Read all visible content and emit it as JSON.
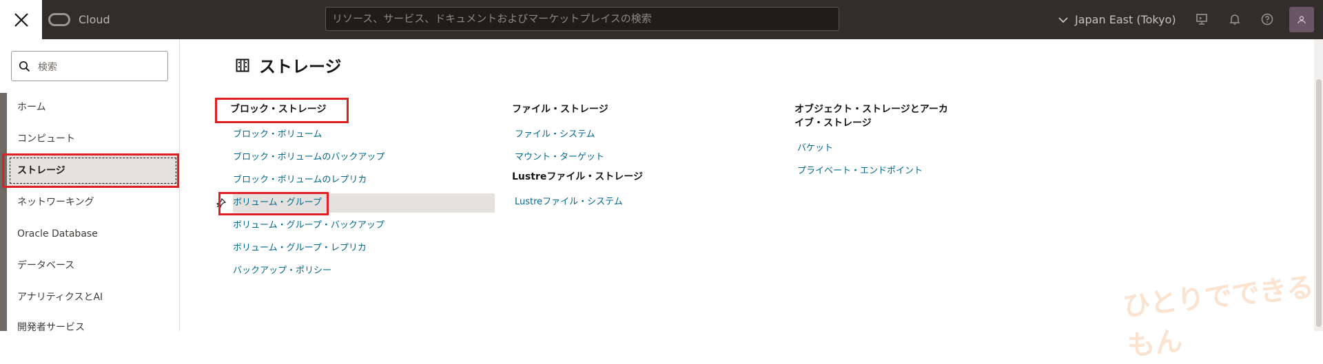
{
  "topbar": {
    "brand": "Cloud",
    "search_placeholder": "リソース、サービス、ドキュメントおよびマーケットプレイスの検索",
    "region": "Japan East (Tokyo)"
  },
  "sidebar": {
    "search_placeholder": "検索",
    "items": [
      {
        "label": "ホーム"
      },
      {
        "label": "コンピュート"
      },
      {
        "label": "ストレージ"
      },
      {
        "label": "ネットワーキング"
      },
      {
        "label": "Oracle Database"
      },
      {
        "label": "データベース"
      },
      {
        "label": "アナリティクスとAI"
      },
      {
        "label": "開発者サービス"
      }
    ]
  },
  "main": {
    "title": "ストレージ",
    "columns": [
      {
        "groups": [
          {
            "heading": "ブロック・ストレージ",
            "links": [
              "ブロック・ボリューム",
              "ブロック・ボリュームのバックアップ",
              "ブロック・ボリュームのレプリカ",
              "ボリューム・グループ",
              "ボリューム・グループ・バックアップ",
              "ボリューム・グループ・レプリカ",
              "バックアップ・ポリシー"
            ]
          }
        ]
      },
      {
        "groups": [
          {
            "heading": "ファイル・ストレージ",
            "links": [
              "ファイル・システム",
              "マウント・ターゲット"
            ]
          },
          {
            "heading": "Lustreファイル・ストレージ",
            "links": [
              "Lustreファイル・システム"
            ]
          }
        ]
      },
      {
        "groups": [
          {
            "heading": "オブジェクト・ストレージとアーカイブ・ストレージ",
            "links": [
              "バケット",
              "プライベート・エンドポイント"
            ]
          }
        ]
      }
    ]
  },
  "watermark": "ひとりでできるもん",
  "colors": {
    "topbar": "#312d2a",
    "link": "#00688c",
    "highlight": "#e02020",
    "active_bg": "#e4e1df"
  }
}
